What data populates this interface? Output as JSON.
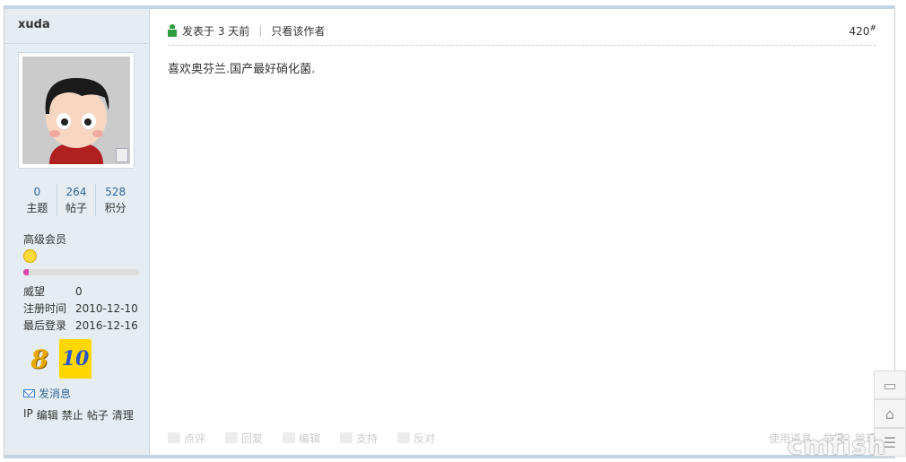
{
  "user": {
    "name": "xuda",
    "stats": [
      {
        "num": "0",
        "label": "主题"
      },
      {
        "num": "264",
        "label": "帖子"
      },
      {
        "num": "528",
        "label": "积分"
      }
    ],
    "rank": "高级会员",
    "progress": 0.05,
    "info": [
      {
        "key": "威望",
        "val": "0"
      },
      {
        "key": "注册时间",
        "val": "2010-12-10"
      },
      {
        "key": "最后登录",
        "val": "2016-12-16"
      }
    ],
    "medals": [
      "8",
      "10"
    ],
    "send_message": "发消息",
    "admin": [
      "IP",
      "编辑",
      "禁止",
      "帖子",
      "清理"
    ]
  },
  "post": {
    "posted": "发表于 3 天前",
    "only_author": "只看该作者",
    "floor": "420",
    "floor_mark": "#",
    "content": "喜欢奥芬兰.国产最好硝化菌."
  },
  "footer": {
    "actions": [
      "点评",
      "回复",
      "编辑",
      "支持",
      "反对"
    ],
    "right": [
      "使用道具",
      "举报",
      "管理"
    ]
  },
  "watermark": "cmfish"
}
